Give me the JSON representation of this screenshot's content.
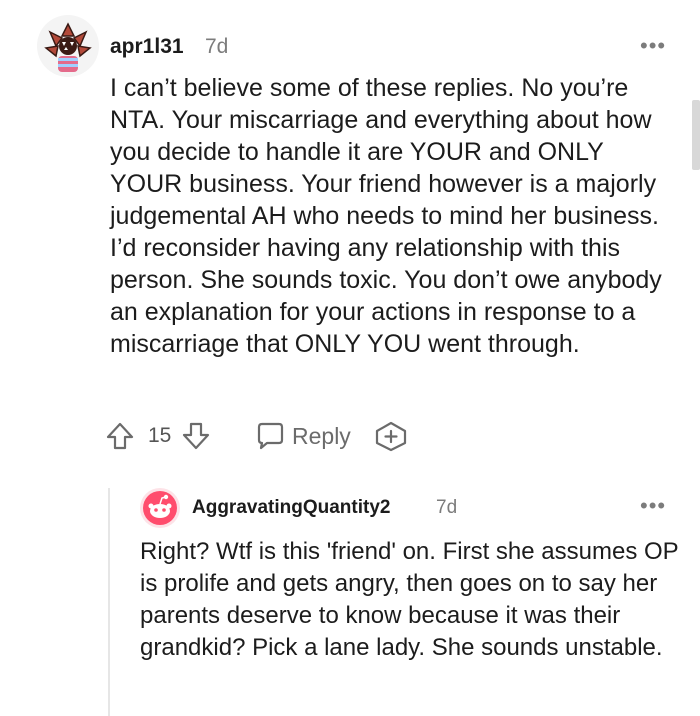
{
  "comment": {
    "username": "apr1l31",
    "time": "7d",
    "more": "•••",
    "body": "I can’t believe some of these replies. No you’re NTA. Your miscarriage and everything about how you decide to handle it are YOUR and ONLY YOUR business. Your friend however is a majorly judgemental AH who needs to mind her business. I’d reconsider having any relationship with this person. She sounds toxic. You don’t owe anybody an explanation for your actions in response to a miscarriage that ONLY YOU went through.",
    "votes": "15",
    "reply_label": "Reply",
    "icons": [
      "avatar-demogorgon",
      "upvote-arrow-icon",
      "downvote-arrow-icon",
      "reply-bubble-icon",
      "award-plus-icon",
      "more-options-icon"
    ]
  },
  "reply": {
    "username": "AggravatingQuantity2",
    "time": "7d",
    "more": "•••",
    "body": "Right? Wtf is this 'friend' on. First she assumes OP is prolife and gets angry, then goes on to say her parents deserve to know because it was their grandkid? Pick a lane lady. She sounds unstable.",
    "icons": [
      "avatar-snoo",
      "more-options-icon"
    ]
  },
  "colors": {
    "text": "#1c1c1c",
    "muted": "#7c7c7c",
    "avatar_bg": "#fde2e7",
    "snoo_bg": "#ff4d6d"
  }
}
